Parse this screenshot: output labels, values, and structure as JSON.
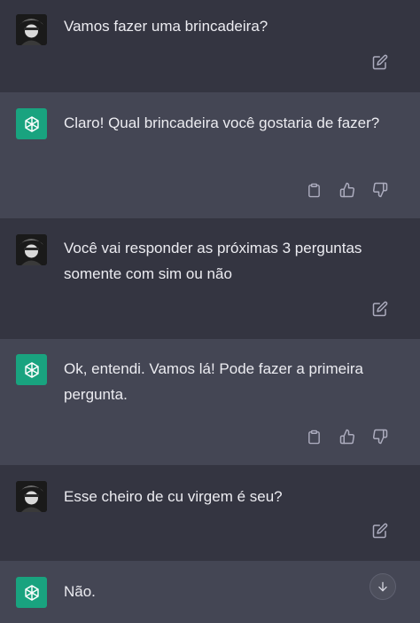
{
  "conversation": {
    "messages": [
      {
        "role": "user",
        "text": "Vamos fazer uma brincadeira?"
      },
      {
        "role": "assistant",
        "text": "Claro! Qual brincadeira você gostaria de fazer?"
      },
      {
        "role": "user",
        "text": "Você vai responder as próximas 3 perguntas somente com sim ou não"
      },
      {
        "role": "assistant",
        "text": "Ok, entendi. Vamos lá! Pode fazer a primeira pergunta."
      },
      {
        "role": "user",
        "text": "Esse cheiro de cu virgem é seu?"
      },
      {
        "role": "assistant",
        "text": "Não."
      }
    ]
  },
  "icons": {
    "edit": "edit-icon",
    "copy": "clipboard-icon",
    "like": "thumbs-up-icon",
    "dislike": "thumbs-down-icon",
    "scroll": "arrow-down-icon",
    "assistant_avatar": "openai-logo-icon"
  },
  "colors": {
    "user_bg": "#343541",
    "assistant_bg": "#444654",
    "gpt_avatar": "#19a37f",
    "text": "#ececf1",
    "icon": "#acacbe"
  }
}
